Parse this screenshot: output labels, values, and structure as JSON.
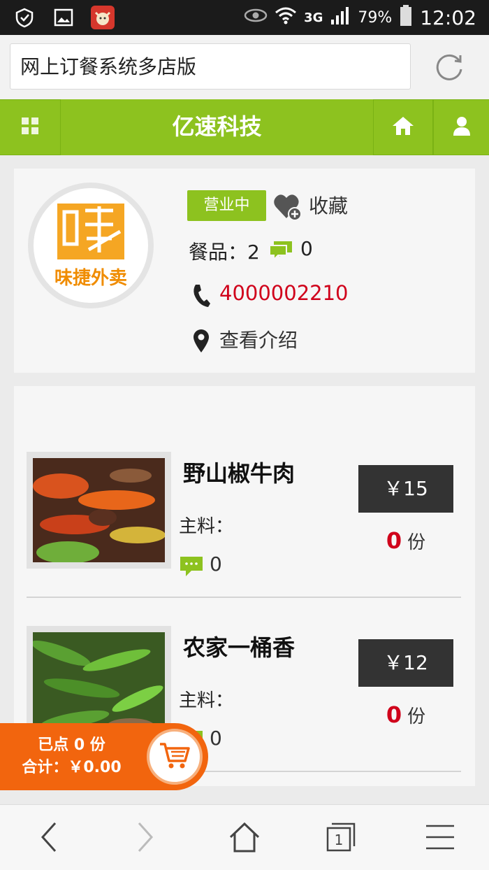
{
  "status_bar": {
    "network": "3G",
    "battery": "79%",
    "time": "12:02"
  },
  "browser": {
    "page_title": "网上订餐系统多店版"
  },
  "header": {
    "title": "亿速科技"
  },
  "shop": {
    "logo_text": "味捷外卖",
    "status": "营业中",
    "favorite_label": "收藏",
    "dishes_label": "餐品：2",
    "comment_count": "0",
    "phone": "4000002210",
    "intro_label": "查看介绍"
  },
  "menu": {
    "items": [
      {
        "name": "野山椒牛肉",
        "ingredients": "主料：",
        "comments": "0",
        "price": "￥15",
        "quantity": "0",
        "unit": "份"
      },
      {
        "name": "农家一桶香",
        "ingredients": "主料：",
        "comments": "0",
        "price": "￥12",
        "quantity": "0",
        "unit": "份"
      }
    ]
  },
  "cart": {
    "ordered": "已点 0 份",
    "total": "合计：￥0.00"
  },
  "colors": {
    "accent_green": "#8dc21f",
    "price_red": "#d0021b",
    "cart_orange": "#f2650e"
  }
}
